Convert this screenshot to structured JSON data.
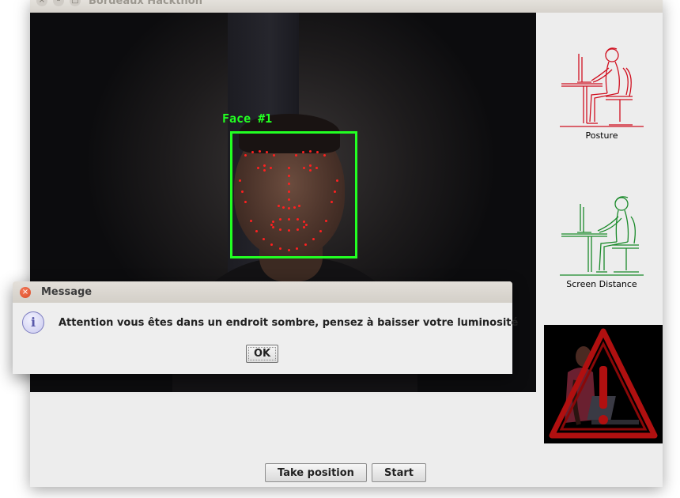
{
  "window": {
    "title": "Bordeaux Hackthon",
    "controls": {
      "close_glyph": "×",
      "minimize_glyph": "–",
      "maximize_glyph": "□"
    }
  },
  "camera": {
    "face_label": "Face #1",
    "box_color": "#22ff22",
    "landmark_color": "#ff2020"
  },
  "side_panel": {
    "posture_label": "Posture",
    "posture_icon": "posture-icon",
    "posture_color": "#d01020",
    "distance_label": "Screen Distance",
    "distance_icon": "screen-distance-icon",
    "distance_color": "#1a8a2a",
    "alert_icon": "warning-triangle-icon",
    "alert_color": "#b01010"
  },
  "buttons": {
    "take_position": "Take position",
    "start": "Start"
  },
  "dialog": {
    "title": "Message",
    "icon": "info-icon",
    "icon_glyph": "i",
    "close_glyph": "×",
    "message": "Attention vous êtes dans un endroit sombre, pensez à baisser votre luminosité",
    "ok_label": "OK"
  }
}
